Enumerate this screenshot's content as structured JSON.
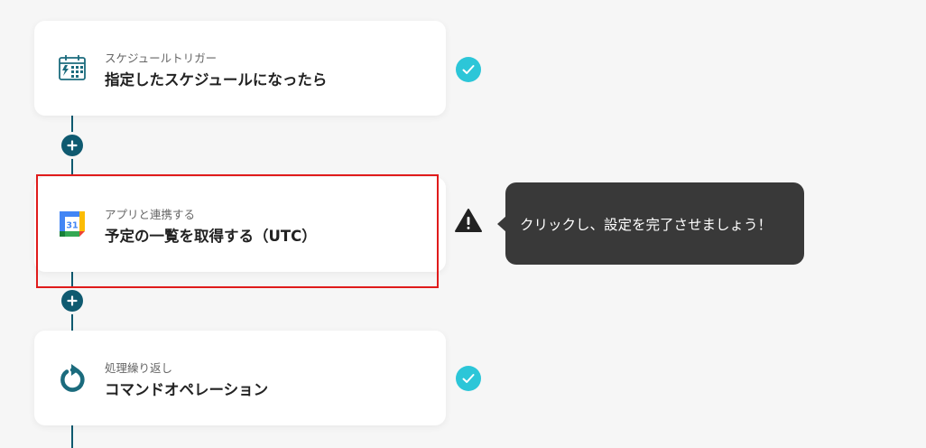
{
  "steps": [
    {
      "subtitle": "スケジュールトリガー",
      "title": "指定したスケジュールになったら",
      "icon": "schedule-trigger-icon",
      "status": "complete"
    },
    {
      "subtitle": "アプリと連携する",
      "title": "予定の一覧を取得する（UTC）",
      "icon": "google-calendar-icon",
      "icon_text": "31",
      "status": "warning"
    },
    {
      "subtitle": "処理繰り返し",
      "title": "コマンドオペレーション",
      "icon": "loop-icon",
      "status": "complete"
    }
  ],
  "tooltip": {
    "text": "クリックし、設定を完了させましょう！"
  },
  "colors": {
    "connector": "#0f5a70",
    "check": "#2cc6d8",
    "highlight": "#e01b1b",
    "tooltip_bg": "#393939",
    "icon_teal": "#1b6b7d"
  }
}
